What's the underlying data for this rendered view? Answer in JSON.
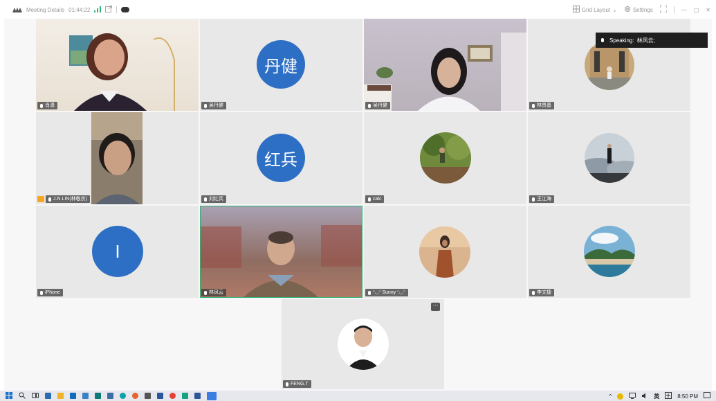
{
  "titlebar": {
    "meeting_details": "Meeting Details",
    "timer": "01:44:22",
    "grid_layout": "Grid Layout",
    "settings": "Settings"
  },
  "speaking": {
    "label": "Speaking:",
    "name": "林风云;"
  },
  "tiles": [
    {
      "name": "肖潇"
    },
    {
      "name": "吴丹健",
      "initials": "丹健"
    },
    {
      "name": "吴丹健"
    },
    {
      "name": "林贵基"
    },
    {
      "name": "J.N.LIN(林敬农)"
    },
    {
      "name": "刘红兵",
      "initials": "红兵"
    },
    {
      "name": "calc"
    },
    {
      "name": "王江海"
    },
    {
      "name": "iPhone",
      "initials": "I"
    },
    {
      "name": "林风云"
    },
    {
      "name": "ᵔ◡ᵔ Sunny ᵔ◡ᵔ"
    },
    {
      "name": "李文捷"
    },
    {
      "name": "FENG.T"
    }
  ],
  "taskbar": {
    "lang": "英",
    "time": "8:50 PM"
  },
  "colors": {
    "avatar_blue": "#2d6fc4",
    "active_border": "#2bb673"
  }
}
